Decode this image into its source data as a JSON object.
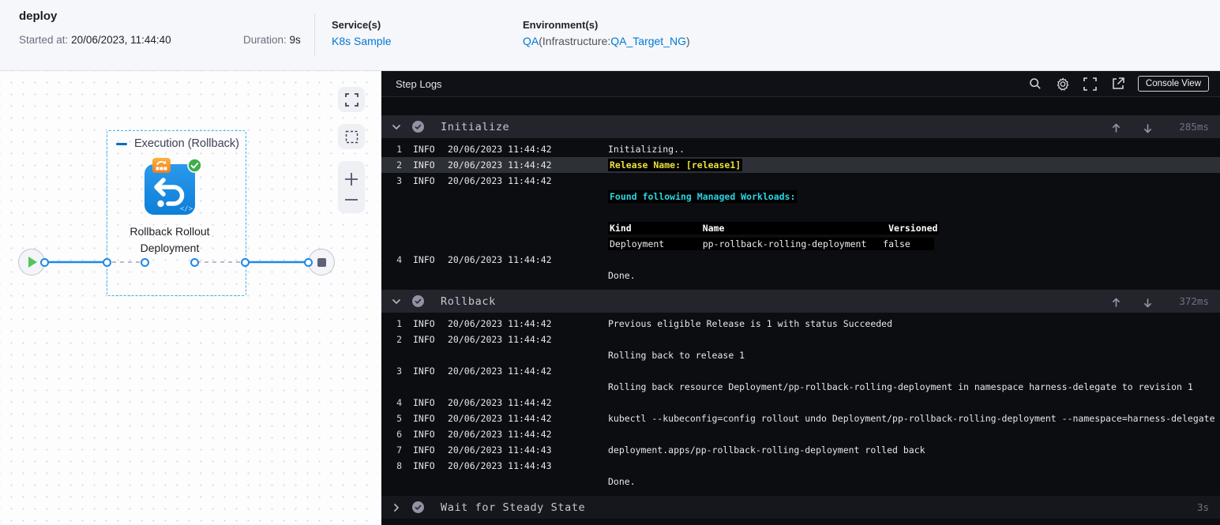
{
  "header": {
    "title": "deploy",
    "started_label": "Started at:",
    "started_value": "20/06/2023, 11:44:40",
    "duration_label": "Duration:",
    "duration_value": "9s",
    "services_label": "Service(s)",
    "services_value": "K8s Sample",
    "environments_label": "Environment(s)",
    "env_name": "QA",
    "env_infra_open": "(Infrastructure:",
    "env_infra_value": "QA_Target_NG",
    "env_infra_close": ")"
  },
  "canvas": {
    "group_label": "Execution (Rollback)",
    "step_label": "Rollback Rollout Deployment",
    "code_glyph": "</>",
    "controls": [
      "fullscreen-icon",
      "marquee-select-icon",
      "zoom-in-icon",
      "zoom-out-icon"
    ]
  },
  "console": {
    "title": "Step Logs",
    "toolbar_icons": [
      "search-icon",
      "settings-gear-icon",
      "fullscreen-icon",
      "open-in-new-icon"
    ],
    "console_view_label": "Console View",
    "sections": [
      {
        "title": "Initialize",
        "duration": "285ms",
        "collapsed": false,
        "logs": [
          {
            "n": "1",
            "level": "INFO",
            "time": "20/06/2023 11:44:42",
            "highlighted": false,
            "lines": [
              {
                "style": "plain",
                "text": "Initializing.."
              }
            ]
          },
          {
            "n": "2",
            "level": "INFO",
            "time": "20/06/2023 11:44:42",
            "highlighted": true,
            "lines": [
              {
                "style": "yellow",
                "text": "Release Name: [release1]"
              }
            ]
          },
          {
            "n": "3",
            "level": "INFO",
            "time": "20/06/2023 11:44:42",
            "highlighted": false,
            "lines": [
              {
                "style": "blank",
                "text": ""
              },
              {
                "style": "cyan",
                "text": "Found following Managed Workloads:"
              },
              {
                "style": "blank",
                "text": ""
              },
              {
                "style": "table-header",
                "text": "Kind             Name                              Versioned"
              },
              {
                "style": "table-row",
                "text": "Deployment       pp-rollback-rolling-deployment   false    "
              }
            ]
          },
          {
            "n": "4",
            "level": "INFO",
            "time": "20/06/2023 11:44:42",
            "highlighted": false,
            "lines": [
              {
                "style": "blank",
                "text": ""
              },
              {
                "style": "plain",
                "text": "Done."
              }
            ]
          }
        ]
      },
      {
        "title": "Rollback",
        "duration": "372ms",
        "collapsed": false,
        "logs": [
          {
            "n": "1",
            "level": "INFO",
            "time": "20/06/2023 11:44:42",
            "highlighted": false,
            "lines": [
              {
                "style": "plain",
                "text": "Previous eligible Release is 1 with status Succeeded"
              }
            ]
          },
          {
            "n": "2",
            "level": "INFO",
            "time": "20/06/2023 11:44:42",
            "highlighted": false,
            "lines": [
              {
                "style": "blank",
                "text": ""
              },
              {
                "style": "plain",
                "text": "Rolling back to release 1"
              }
            ]
          },
          {
            "n": "3",
            "level": "INFO",
            "time": "20/06/2023 11:44:42",
            "highlighted": false,
            "lines": [
              {
                "style": "blank",
                "text": ""
              },
              {
                "style": "plain",
                "text": "Rolling back resource Deployment/pp-rollback-rolling-deployment in namespace harness-delegate to revision 1"
              }
            ]
          },
          {
            "n": "4",
            "level": "INFO",
            "time": "20/06/2023 11:44:42",
            "highlighted": false,
            "lines": [
              {
                "style": "blank",
                "text": ""
              }
            ]
          },
          {
            "n": "5",
            "level": "INFO",
            "time": "20/06/2023 11:44:42",
            "highlighted": false,
            "lines": [
              {
                "style": "plain",
                "text": "kubectl --kubeconfig=config rollout undo Deployment/pp-rollback-rolling-deployment --namespace=harness-delegate"
              }
            ]
          },
          {
            "n": "6",
            "level": "INFO",
            "time": "20/06/2023 11:44:42",
            "highlighted": false,
            "lines": [
              {
                "style": "blank",
                "text": ""
              }
            ]
          },
          {
            "n": "7",
            "level": "INFO",
            "time": "20/06/2023 11:44:43",
            "highlighted": false,
            "lines": [
              {
                "style": "plain",
                "text": "deployment.apps/pp-rollback-rolling-deployment rolled back"
              }
            ]
          },
          {
            "n": "8",
            "level": "INFO",
            "time": "20/06/2023 11:44:43",
            "highlighted": false,
            "lines": [
              {
                "style": "blank",
                "text": ""
              },
              {
                "style": "plain",
                "text": "Done."
              }
            ]
          }
        ]
      },
      {
        "title": "Wait for Steady State",
        "duration": "3s",
        "collapsed": true,
        "logs": []
      }
    ]
  },
  "colors": {
    "link_blue": "#0278d5",
    "node_blue": "#108de8",
    "success_green": "#3fae4a",
    "log_yellow": "#e9e13b",
    "log_cyan": "#2bd4e4",
    "group_border": "#35b5e8"
  }
}
